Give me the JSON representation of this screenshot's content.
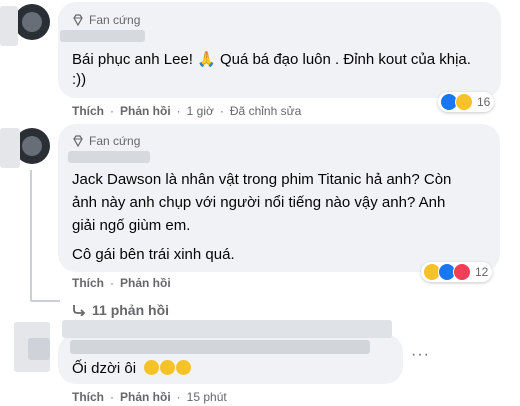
{
  "comments": [
    {
      "badge": "Fan cứng",
      "text": "Bái phục anh Lee! 🙏 Quá bá đạo luôn . Đỉnh kout của khịa. :))",
      "actions": {
        "like": "Thích",
        "reply": "Phản hồi",
        "time": "1 giờ",
        "edited": "Đã chỉnh sửa"
      },
      "reactions": {
        "count": "16",
        "types": [
          "like-icon",
          "haha-icon"
        ]
      }
    },
    {
      "badge": "Fan cứng",
      "text_lines": [
        "Jack Dawson là nhân vật trong phim Titanic hả anh? Còn",
        "ảnh này anh chụp với người nổi tiếng nào vậy anh? Anh",
        "giải ngố giùm em."
      ],
      "text2": "Cô gái bên trái xinh quá.",
      "actions": {
        "like": "Thích",
        "reply": "Phản hồi"
      },
      "reactions": {
        "count": "12",
        "types": [
          "haha-icon",
          "like-icon",
          "love-icon"
        ]
      },
      "replies_label": "11 phản hồi"
    },
    {
      "text": "Ối dzời ôi",
      "actions": {
        "like": "Thích",
        "reply": "Phản hồi",
        "time": "15 phút"
      },
      "more": "···"
    }
  ]
}
